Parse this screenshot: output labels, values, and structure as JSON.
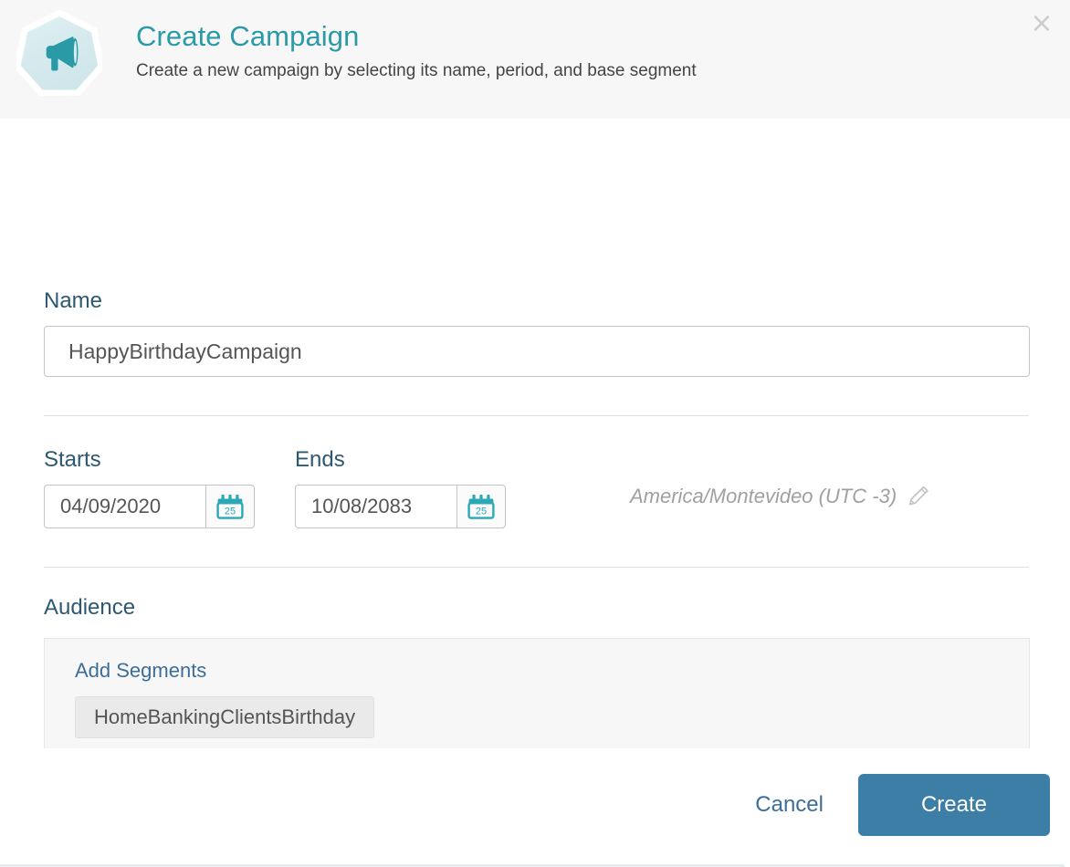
{
  "header": {
    "title": "Create Campaign",
    "subtitle": "Create a new campaign by selecting its name, period, and base segment",
    "icon": "megaphone-icon",
    "close_icon": "close-icon",
    "close_label": "×",
    "accent_color": "#2a9aa6",
    "background": "#f7f7f7"
  },
  "form": {
    "name": {
      "label": "Name",
      "value": "HappyBirthdayCampaign",
      "placeholder": "Name"
    },
    "starts": {
      "label": "Starts",
      "value": "04/09/2020",
      "placeholder": "mm/dd/yyyy",
      "calendar_icon": "calendar-icon",
      "calendar_day": "25"
    },
    "ends": {
      "label": "Ends",
      "value": "10/08/2083",
      "placeholder": "mm/dd/yyyy",
      "calendar_icon": "calendar-icon",
      "calendar_day": "25"
    },
    "timezone": {
      "text": "America/Montevideo (UTC -3)",
      "edit_icon": "pencil-icon"
    },
    "audience": {
      "label": "Audience",
      "add_segments_label": "Add Segments",
      "segments": [
        {
          "label": "HomeBankingClientsBirthday"
        }
      ]
    }
  },
  "footer": {
    "cancel_label": "Cancel",
    "create_label": "Create",
    "primary_color": "#3d7ea6",
    "link_color": "#3d6e99"
  }
}
